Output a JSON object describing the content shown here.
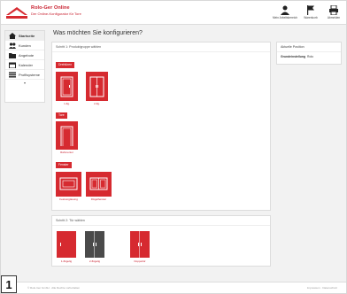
{
  "header": {
    "brand_title": "Rolo-Ger Online",
    "brand_subtitle": "Der Online-Konfigurator für Tore",
    "actions": [
      {
        "label": "Mein Arbeitsbereich",
        "icon": "user-icon"
      },
      {
        "label": "Warenkorb",
        "icon": "flag-icon"
      },
      {
        "label": "Abmelden",
        "icon": "print-icon"
      }
    ]
  },
  "sidebar": {
    "items": [
      {
        "label": "Startseite",
        "icon": "home-icon"
      },
      {
        "label": "Kunden",
        "icon": "users-icon"
      },
      {
        "label": "Angebote",
        "icon": "folder-icon"
      },
      {
        "label": "Kalender",
        "icon": "calendar-icon"
      },
      {
        "label": "Profilsysteme",
        "icon": "list-icon"
      }
    ],
    "more": "▾"
  },
  "main": {
    "page_title": "Was möchten Sie konfigurieren?",
    "panel_head": "Schritt 1: Produktgruppe wählen",
    "categories": [
      {
        "label": "Drehtüren",
        "tiles": [
          {
            "caption": "1-flg."
          },
          {
            "caption": "2-flg."
          }
        ]
      },
      {
        "label": "Tore",
        "tiles": [
          {
            "caption": "Rahmentor"
          }
        ]
      },
      {
        "label": "Fenster",
        "tiles": [
          {
            "caption": "Festverglasung"
          },
          {
            "caption": "Flügelfenster"
          }
        ]
      }
    ],
    "color_panel_head": "Schritt 2: Tür wählen",
    "colors": [
      {
        "caption": "1-flügelig",
        "color": "#d62a30"
      },
      {
        "caption": "2-flügelig",
        "color": "#4a4a4a"
      },
      {
        "caption": "Doppeltür",
        "color": "#d62a30"
      }
    ]
  },
  "info": {
    "title": "Aktuelle Position",
    "rows": [
      {
        "key": "Grundeinstellung",
        "value": "Rolo"
      }
    ]
  },
  "footer": {
    "left": "© Rolo-Ger GmbH · Alle Rechte vorbehalten",
    "right": "Impressum · Datenschutz"
  },
  "page_number": "1",
  "accent": "#d62a30"
}
